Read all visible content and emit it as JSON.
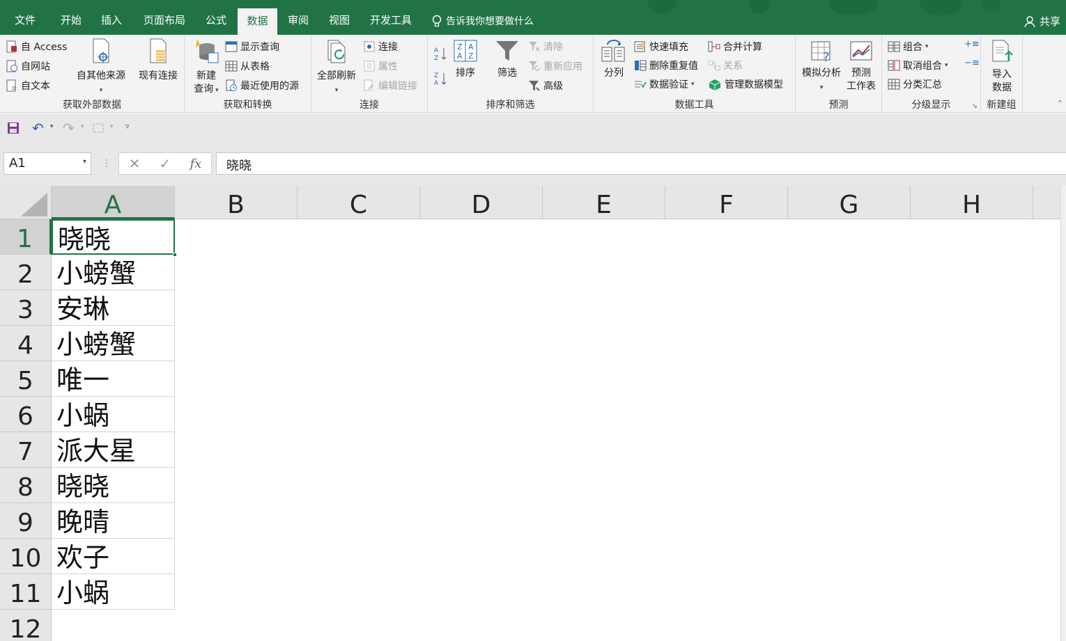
{
  "menu": {
    "tabs": [
      "文件",
      "开始",
      "插入",
      "页面布局",
      "公式",
      "数据",
      "审阅",
      "视图",
      "开发工具"
    ],
    "active_tab": "数据",
    "tell_me": "告诉我你想要做什么",
    "share": "共享"
  },
  "ribbon": {
    "get_external": {
      "label": "获取外部数据",
      "from_access": "自 Access",
      "from_web": "自网站",
      "from_text": "自文本",
      "from_other_line1": "自其他来源",
      "existing_connections": "现有连接"
    },
    "get_transform": {
      "label": "获取和转换",
      "new_query_line1": "新建",
      "new_query_line2": "查询",
      "show_queries": "显示查询",
      "from_table": "从表格",
      "recent_sources": "最近使用的源"
    },
    "connections": {
      "label": "连接",
      "refresh_all": "全部刷新",
      "connections": "连接",
      "properties": "属性",
      "edit_links": "编辑链接"
    },
    "sort_filter": {
      "label": "排序和筛选",
      "sort": "排序",
      "filter": "筛选",
      "clear": "清除",
      "reapply": "重新应用",
      "advanced": "高级"
    },
    "data_tools": {
      "label": "数据工具",
      "text_to_columns": "分列",
      "flash_fill": "快速填充",
      "remove_duplicates": "删除重复值",
      "data_validation": "数据验证",
      "consolidate": "合并计算",
      "relationships": "关系",
      "manage_data_model": "管理数据模型"
    },
    "forecast": {
      "label": "预测",
      "what_if": "模拟分析",
      "forecast_sheet_line1": "预测",
      "forecast_sheet_line2": "工作表"
    },
    "outline": {
      "label": "分级显示",
      "group": "组合",
      "ungroup": "取消组合",
      "subtotal": "分类汇总"
    },
    "new_group": {
      "label": "新建组",
      "import_line1": "导入",
      "import_line2": "数据"
    }
  },
  "formula_bar": {
    "name_box": "A1",
    "formula_value": "晓晓",
    "cancel_symbol": "✕",
    "enter_symbol": "✓",
    "fx_symbol": "fx"
  },
  "sheet": {
    "columns": [
      "A",
      "B",
      "C",
      "D",
      "E",
      "F",
      "G",
      "H"
    ],
    "rows": [
      "1",
      "2",
      "3",
      "4",
      "5",
      "6",
      "7",
      "8",
      "9",
      "10",
      "11",
      "12"
    ],
    "column_a": [
      "晓晓",
      "小螃蟹",
      "安琳",
      "小螃蟹",
      "唯一",
      "小蜗",
      "派大星",
      "晓晓",
      "晚晴",
      "欢子",
      "小蜗",
      ""
    ],
    "active_cell": "A1"
  },
  "colors": {
    "brand": "#217346",
    "ribbon_bg": "#f3f3f3",
    "header_bg": "#e6e6e6"
  }
}
